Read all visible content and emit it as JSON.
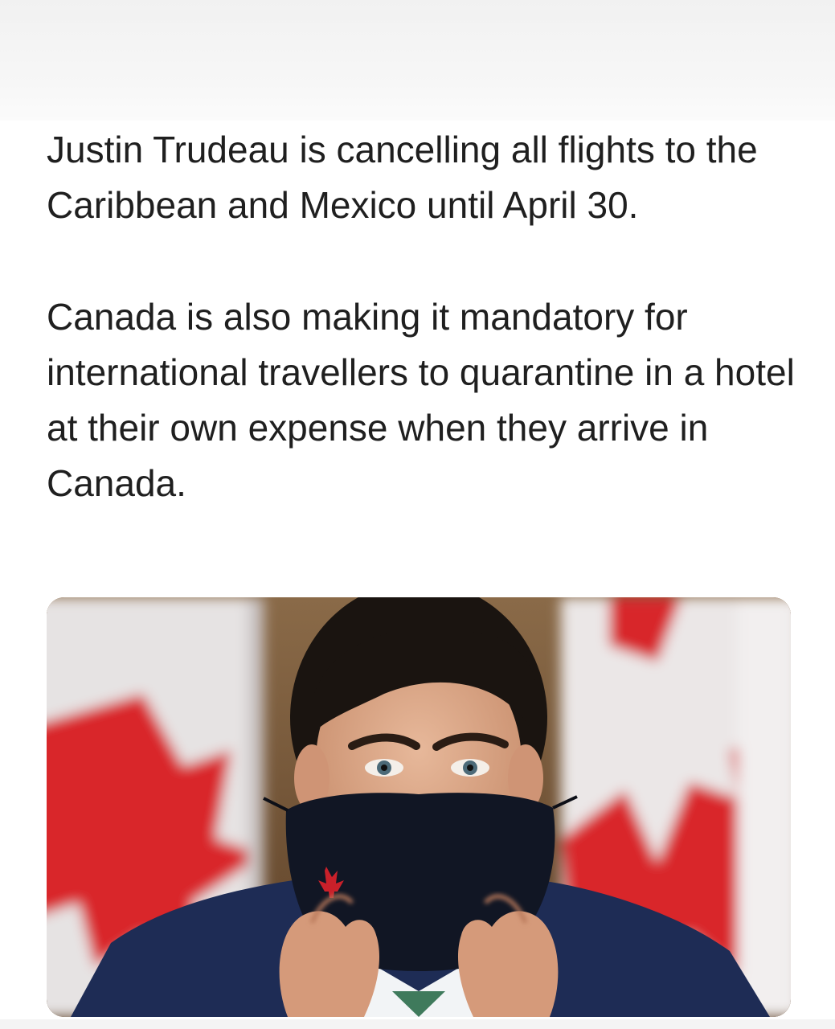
{
  "post": {
    "paragraphs": [
      "Justin Trudeau is cancelling all flights to the Caribbean and Mexico until April 30.",
      "Canada is also making it mandatory for international travellers to quarantine in a hotel at their own expense when they arrive in Canada."
    ],
    "image": {
      "icon": "photo-man-wearing-mask-with-canadian-flags",
      "colors": {
        "flag_red": "#d9262c",
        "flag_white": "#ececec",
        "mask": "#111624",
        "suit": "#1e2c55"
      }
    }
  }
}
